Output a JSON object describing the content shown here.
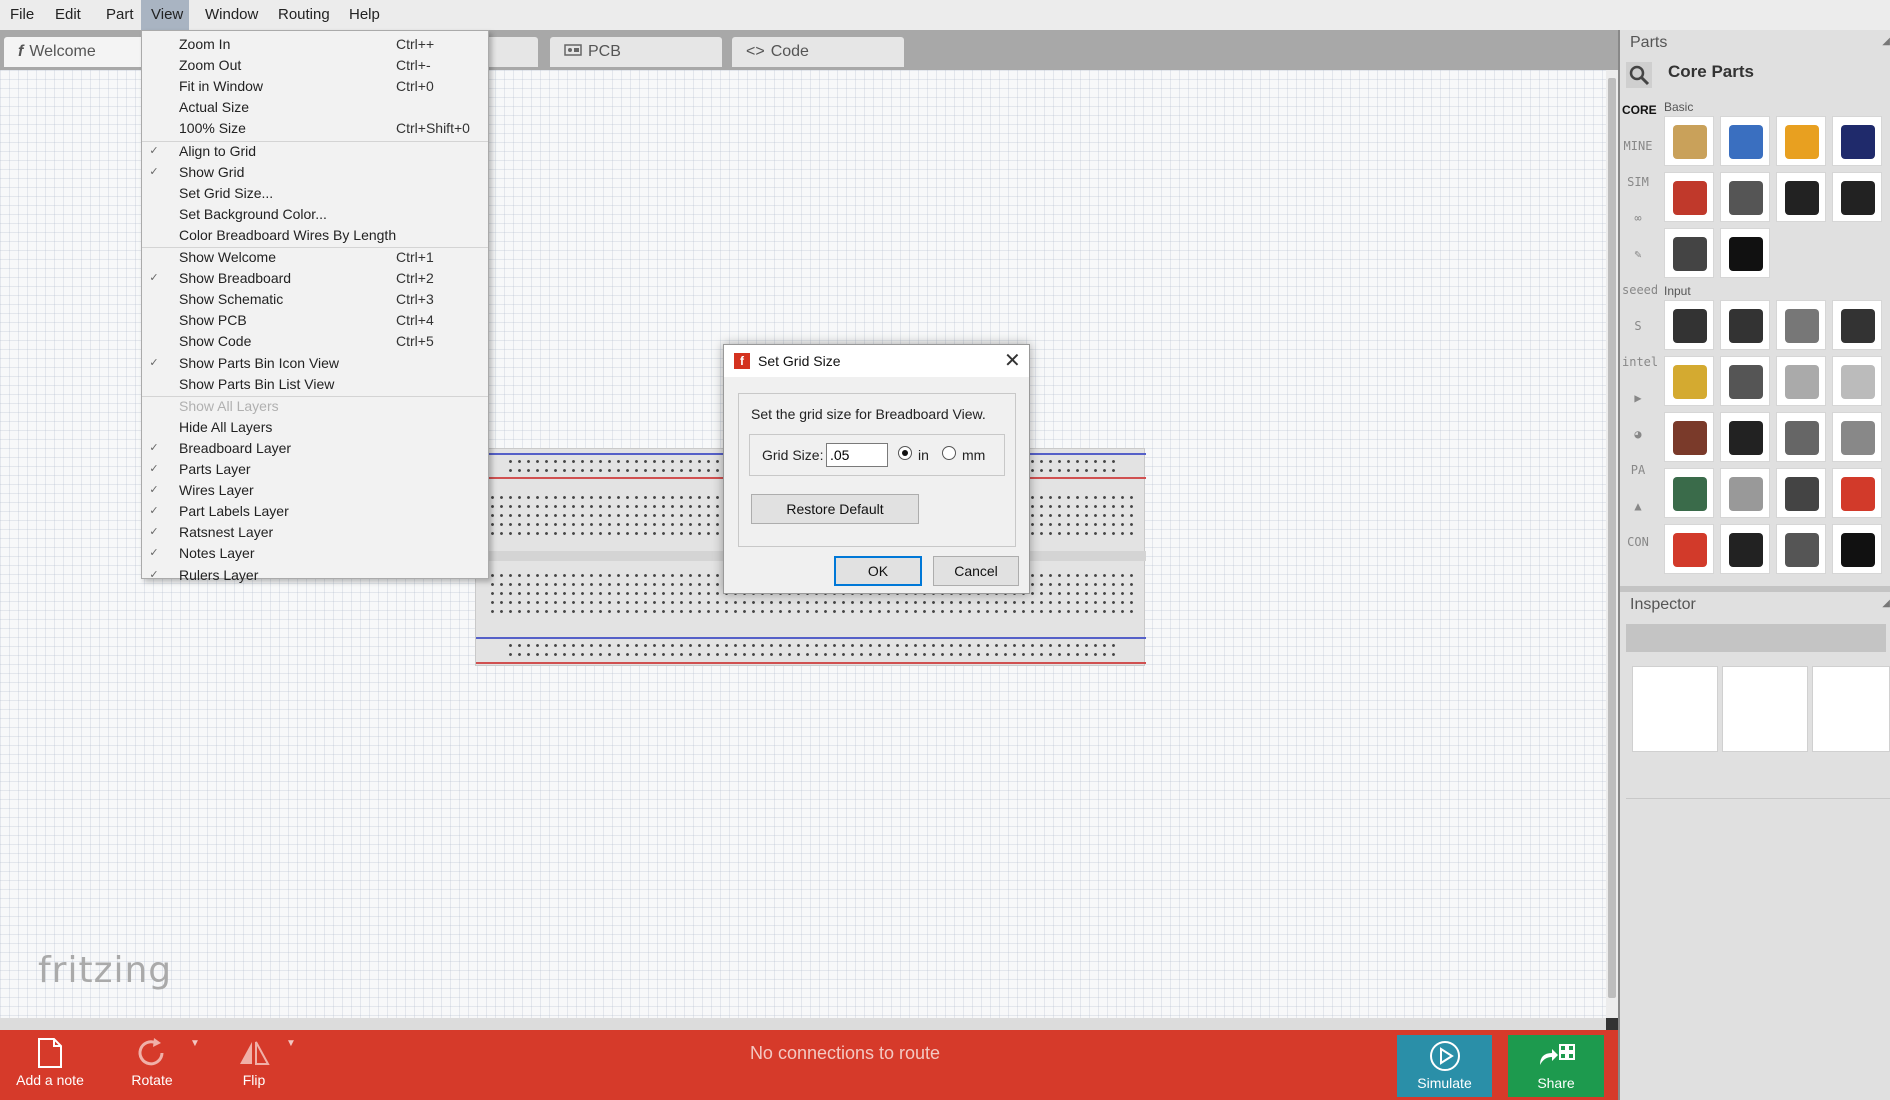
{
  "menubar": {
    "items": [
      "File",
      "Edit",
      "Part",
      "View",
      "Window",
      "Routing",
      "Help"
    ],
    "active": "View"
  },
  "tabs": [
    {
      "icon": "welcome-icon",
      "label": "Welcome"
    },
    {
      "icon": "breadboard-icon",
      "label": ""
    },
    {
      "icon": "pcb-icon",
      "label": "PCB"
    },
    {
      "icon": "code-icon",
      "label": "Code"
    }
  ],
  "view_menu": {
    "items": [
      {
        "label": "Zoom In",
        "shortcut": "Ctrl++",
        "checked": false,
        "enabled": true
      },
      {
        "label": "Zoom Out",
        "shortcut": "Ctrl+-",
        "checked": false,
        "enabled": true
      },
      {
        "label": "Fit in Window",
        "shortcut": "Ctrl+0",
        "checked": false,
        "enabled": true
      },
      {
        "label": "Actual Size",
        "shortcut": "",
        "checked": false,
        "enabled": true
      },
      {
        "label": "100% Size",
        "shortcut": "Ctrl+Shift+0",
        "checked": false,
        "enabled": true
      },
      {
        "label": "Align to Grid",
        "shortcut": "",
        "checked": true,
        "enabled": true
      },
      {
        "label": "Show Grid",
        "shortcut": "",
        "checked": true,
        "enabled": true
      },
      {
        "label": "Set Grid Size...",
        "shortcut": "",
        "checked": false,
        "enabled": true
      },
      {
        "label": "Set Background Color...",
        "shortcut": "",
        "checked": false,
        "enabled": true
      },
      {
        "label": "Color Breadboard Wires By Length",
        "shortcut": "",
        "checked": false,
        "enabled": true
      },
      {
        "label": "Show Welcome",
        "shortcut": "Ctrl+1",
        "checked": false,
        "enabled": true
      },
      {
        "label": "Show Breadboard",
        "shortcut": "Ctrl+2",
        "checked": true,
        "enabled": true
      },
      {
        "label": "Show Schematic",
        "shortcut": "Ctrl+3",
        "checked": false,
        "enabled": true
      },
      {
        "label": "Show PCB",
        "shortcut": "Ctrl+4",
        "checked": false,
        "enabled": true
      },
      {
        "label": "Show Code",
        "shortcut": "Ctrl+5",
        "checked": false,
        "enabled": true
      },
      {
        "label": "Show Parts Bin Icon View",
        "shortcut": "",
        "checked": true,
        "enabled": true
      },
      {
        "label": "Show Parts Bin List View",
        "shortcut": "",
        "checked": false,
        "enabled": true
      },
      {
        "label": "Show All Layers",
        "shortcut": "",
        "checked": false,
        "enabled": false
      },
      {
        "label": "Hide All Layers",
        "shortcut": "",
        "checked": false,
        "enabled": true
      },
      {
        "label": "Breadboard Layer",
        "shortcut": "",
        "checked": true,
        "enabled": true
      },
      {
        "label": "Parts Layer",
        "shortcut": "",
        "checked": true,
        "enabled": true
      },
      {
        "label": "Wires Layer",
        "shortcut": "",
        "checked": true,
        "enabled": true
      },
      {
        "label": "Part Labels Layer",
        "shortcut": "",
        "checked": true,
        "enabled": true
      },
      {
        "label": "Ratsnest Layer",
        "shortcut": "",
        "checked": true,
        "enabled": true
      },
      {
        "label": "Notes Layer",
        "shortcut": "",
        "checked": true,
        "enabled": true
      },
      {
        "label": "Rulers Layer",
        "shortcut": "",
        "checked": true,
        "enabled": true
      }
    ],
    "separators_after": [
      4,
      9,
      16
    ]
  },
  "dialog": {
    "title": "Set Grid Size",
    "description": "Set the grid size for Breadboard View.",
    "grid_size_label": "Grid Size:",
    "grid_size_value": ".05",
    "unit_in": "in",
    "unit_mm": "mm",
    "selected_unit": "in",
    "restore_default": "Restore Default",
    "ok": "OK",
    "cancel": "Cancel",
    "close_glyph": "✕",
    "icon_letter": "f"
  },
  "canvas": {
    "logo": "fritzing"
  },
  "toolbar": {
    "add_note": "Add a note",
    "rotate": "Rotate",
    "flip": "Flip",
    "status": "No connections to route",
    "simulate": "Simulate",
    "share": "Share",
    "color": "#d63a2a",
    "simulate_color": "#2a8fa8",
    "share_color": "#1d9a4e"
  },
  "parts_panel": {
    "title": "Parts",
    "bin_title": "Core Parts",
    "bins": [
      "CORE",
      "MINE",
      "SIM",
      "∞",
      "✎",
      "seeed",
      "S",
      "intel",
      "▶",
      "◕",
      "PA",
      "▲",
      "CON"
    ],
    "active_bin": "CORE",
    "sections": [
      {
        "label": "Basic",
        "items": [
          "resistor",
          "ceramic-capacitor",
          "tantalum-capacitor",
          "electrolytic-capacitor",
          "inductor",
          "diode",
          "pnp-transistor",
          "npn-transistor",
          "fet-transistor",
          "mystery-part"
        ]
      },
      {
        "label": "Input",
        "items": [
          "potentiometer",
          "rotary-potentiometer",
          "slide-potentiometer",
          "trimmer-strip",
          "rotary-encoder",
          "dial-knob",
          "dip-switch-rotary",
          "reed-switch",
          "pushbutton",
          "toggle-switch",
          "slide-switch",
          "tilt-switch",
          "joystick",
          "wire-sensor",
          "thermistor",
          "ir-sensor",
          "piezo-buzzer",
          "sparkfun-board",
          "sparkfun-board-2",
          "temperature-sensor"
        ]
      }
    ]
  },
  "inspector": {
    "title": "Inspector"
  }
}
